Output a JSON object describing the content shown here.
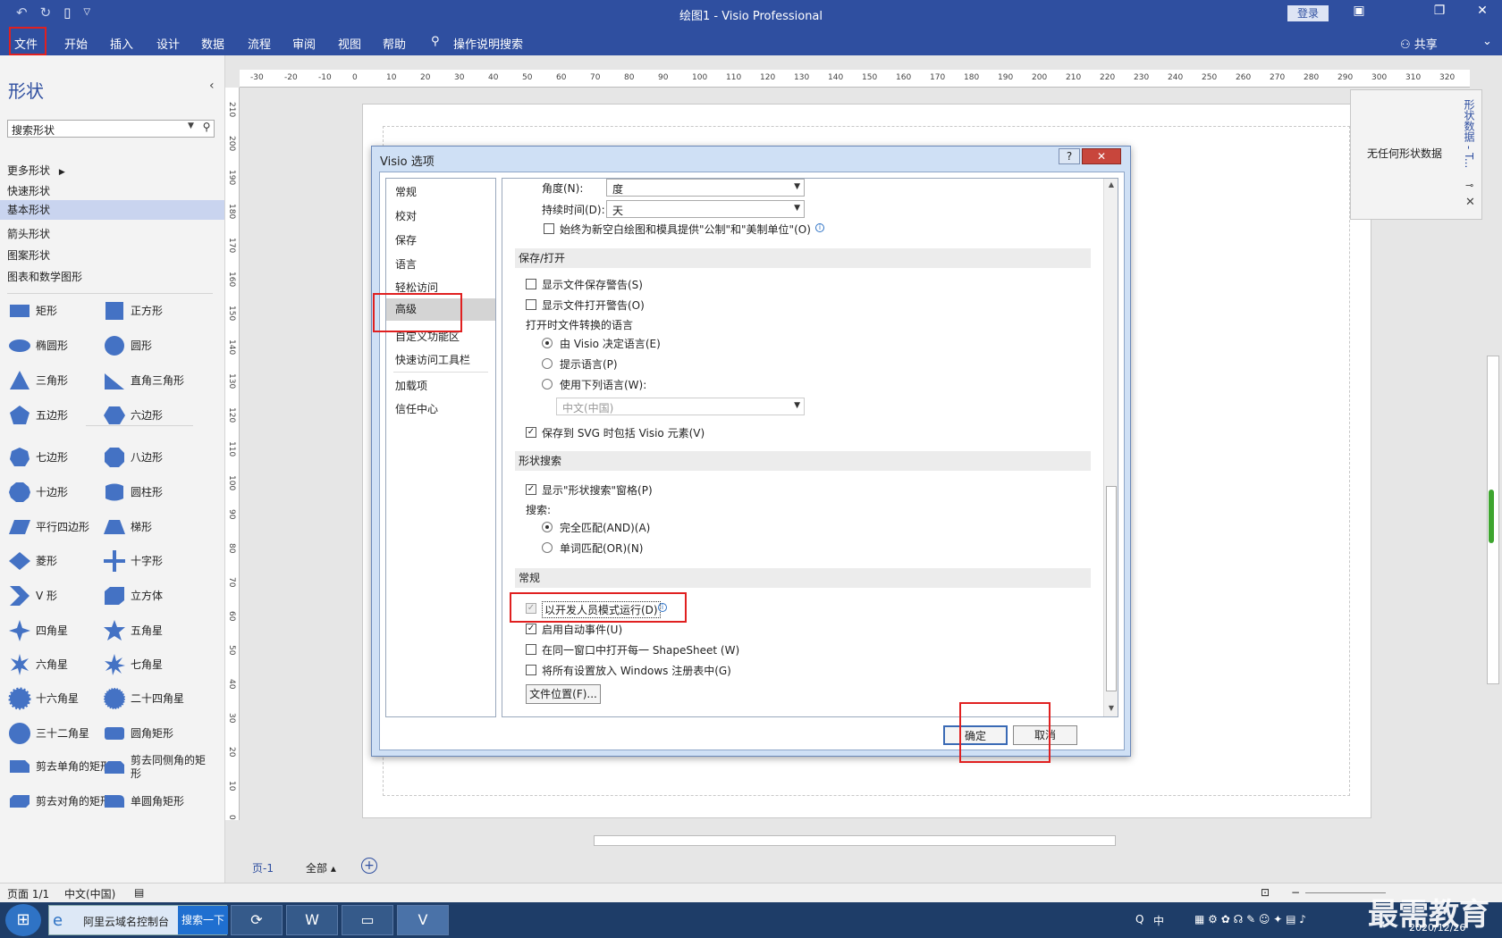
{
  "window": {
    "title": "绘图1  -  Visio Professional",
    "login": "登录",
    "qat_icons": [
      "undo-icon",
      "redo-icon",
      "new-document-icon",
      "customize-icon"
    ]
  },
  "ribbon": {
    "tabs": [
      "文件",
      "开始",
      "插入",
      "设计",
      "数据",
      "流程",
      "审阅",
      "视图",
      "帮助"
    ],
    "tell_me": "操作说明搜索",
    "share": "共享"
  },
  "shapes_pane": {
    "title": "形状",
    "search_placeholder": "搜索形状",
    "stencils": [
      "更多形状",
      "快速形状",
      "基本形状",
      "箭头形状",
      "图案形状",
      "图表和数学图形"
    ],
    "active_stencil": "基本形状",
    "shapes": [
      "矩形",
      "正方形",
      "椭圆形",
      "圆形",
      "三角形",
      "直角三角形",
      "五边形",
      "六边形",
      "七边形",
      "八边形",
      "十边形",
      "圆柱形",
      "平行四边形",
      "梯形",
      "菱形",
      "十字形",
      "V 形",
      "立方体",
      "四角星",
      "五角星",
      "六角星",
      "七角星",
      "十六角星",
      "二十四角星",
      "三十二角星",
      "圆角矩形",
      "剪去单角的矩形",
      "剪去同侧角的矩形",
      "剪去对角的矩形",
      "单圆角矩形"
    ]
  },
  "ruler": {
    "horizontal": [
      "-30",
      "-20",
      "-10",
      "0",
      "10",
      "20",
      "30",
      "40",
      "50",
      "60",
      "70",
      "80",
      "90",
      "100",
      "110",
      "120",
      "130",
      "140",
      "150",
      "160",
      "170",
      "180",
      "190",
      "200",
      "210",
      "220",
      "230",
      "240",
      "250",
      "260",
      "270",
      "280",
      "290",
      "300",
      "310",
      "320"
    ],
    "vertical": [
      "210",
      "200",
      "190",
      "180",
      "170",
      "160",
      "150",
      "140",
      "130",
      "120",
      "110",
      "100",
      "90",
      "80",
      "70",
      "60",
      "50",
      "40",
      "30",
      "20",
      "10",
      "0"
    ]
  },
  "shape_data": {
    "title": "形状数据 - T...",
    "empty_text": "无任何形状数据"
  },
  "page_tabs": {
    "page": "页-1",
    "all": "全部 ▴",
    "add": "+"
  },
  "status": {
    "page": "页面 1/1",
    "language": "中文(中国)"
  },
  "taskbar": {
    "ie_title": "阿里云域名控制台",
    "search_btn": "搜索一下",
    "date": "2020/12/26",
    "watermark": "最需教育",
    "ime": "中"
  },
  "dialog": {
    "title": "Visio 选项",
    "help": "?",
    "close": "✕",
    "nav": [
      "常规",
      "校对",
      "保存",
      "语言",
      "轻松访问",
      "高级",
      "自定义功能区",
      "快速访问工具栏",
      "加载项",
      "信任中心"
    ],
    "selected_nav": "高级",
    "top": {
      "angle_label": "角度(N):",
      "angle_value": "度",
      "duration_label": "持续时间(D):",
      "duration_value": "天",
      "metric_option": "始终为新空白绘图和模具提供\"公制\"和\"美制单位\"(O)"
    },
    "save_open": {
      "header": "保存/打开",
      "show_save_warning": "显示文件保存警告(S)",
      "show_open_warning": "显示文件打开警告(O)",
      "lang_label": "打开时文件转换的语言",
      "radio_visio": "由 Visio 决定语言(E)",
      "radio_prompt": "提示语言(P)",
      "radio_use": "使用下列语言(W):",
      "lang_value": "中文(中国)",
      "svg_option": "保存到 SVG 时包括 Visio 元素(V)"
    },
    "shape_search": {
      "header": "形状搜索",
      "show_pane": "显示\"形状搜索\"窗格(P)",
      "search_label": "搜索:",
      "exact": "完全匹配(AND)(A)",
      "any": "单词匹配(OR)(N)"
    },
    "general": {
      "header": "常规",
      "dev_mode": "以开发人员模式运行(D)",
      "auto_events": "启用自动事件(U)",
      "shapesheet": "在同一窗口中打开每一 ShapeSheet (W)",
      "registry": "将所有设置放入 Windows 注册表中(G)",
      "file_locations": "文件位置(F)..."
    },
    "ok": "确定",
    "cancel": "取消"
  }
}
